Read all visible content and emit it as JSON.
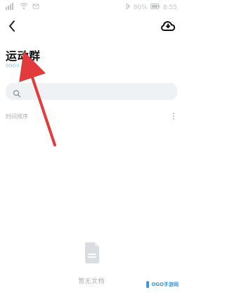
{
  "status_bar": {
    "time": "8:55",
    "battery_percent": "80%",
    "left_icons": [
      "signal-icon",
      "wifi-icon",
      "notification-icon"
    ],
    "right_icons": [
      "bluetooth-icon",
      "battery-icon"
    ]
  },
  "top_bar": {
    "back_icon": "chevron-left-icon",
    "cloud_icon": "cloud-sync-icon"
  },
  "header": {
    "title": "运动群",
    "subtitle": "0GOII 云盘"
  },
  "search": {
    "placeholder": ""
  },
  "sort": {
    "label": "时间排序",
    "more_icon": "more-vertical-icon"
  },
  "empty_state": {
    "icon": "document-icon",
    "text": "暂无文档"
  },
  "watermark": {
    "text": "OGO手游网"
  },
  "colors": {
    "accent_blue": "#2f8bd8",
    "arrow_red": "#e13b3b",
    "search_bg": "#eef2f4",
    "text_primary": "#111111",
    "text_secondary": "#8a8f98"
  }
}
